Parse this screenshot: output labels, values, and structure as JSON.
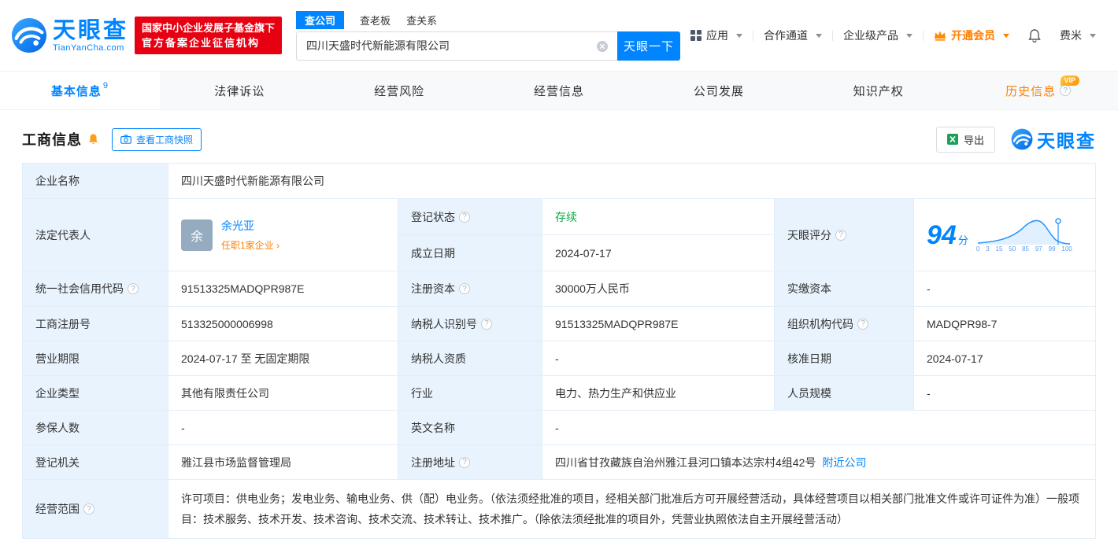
{
  "colors": {
    "accent": "#0084ff",
    "orange": "#ff8000",
    "green": "#0caa45",
    "red": "#e60012",
    "label_bg": "#e9f3fd"
  },
  "header": {
    "logo_cn": "天眼查",
    "logo_en": "TianYanCha.com",
    "badge_line1": "国家中小企业发展子基金旗下",
    "badge_line2": "官方备案企业征信机构",
    "search_tabs": [
      {
        "label": "查公司"
      },
      {
        "label": "查老板"
      },
      {
        "label": "查关系"
      }
    ],
    "search_value": "四川天盛时代新能源有限公司",
    "search_button": "天眼一下",
    "nav_app": "应用",
    "nav_coop": "合作通道",
    "nav_enterprise": "企业级产品",
    "nav_vip": "开通会员",
    "nav_user": "费米"
  },
  "tabs": [
    {
      "label": "基本信息",
      "count": "9"
    },
    {
      "label": "法律诉讼"
    },
    {
      "label": "经营风险"
    },
    {
      "label": "经营信息"
    },
    {
      "label": "公司发展"
    },
    {
      "label": "知识产权"
    },
    {
      "label": "历史信息",
      "vip": "VIP"
    }
  ],
  "section": {
    "title": "工商信息",
    "snapshot_button": "查看工商快照",
    "export_button": "导出",
    "brand": "天眼查"
  },
  "fields": {
    "company_name": {
      "label": "企业名称",
      "value": "四川天盛时代新能源有限公司"
    },
    "legal_rep": {
      "label": "法定代表人",
      "avatar": "余",
      "name": "余光亚",
      "note": "任职1家企业"
    },
    "reg_status": {
      "label": "登记状态",
      "value": "存续"
    },
    "establish_date": {
      "label": "成立日期",
      "value": "2024-07-17"
    },
    "score": {
      "label": "天眼评分",
      "value": "94",
      "unit": "分",
      "axis": [
        "0",
        "3",
        "15",
        "50",
        "85",
        "97",
        "99",
        "100"
      ]
    },
    "credit_code": {
      "label": "统一社会信用代码",
      "value": "91513325MADQPR987E"
    },
    "reg_capital": {
      "label": "注册资本",
      "value": "30000万人民币"
    },
    "paid_capital": {
      "label": "实缴资本",
      "value": "-"
    },
    "reg_number": {
      "label": "工商注册号",
      "value": "513325000006998"
    },
    "taxpayer_id": {
      "label": "纳税人识别号",
      "value": "91513325MADQPR987E"
    },
    "org_code": {
      "label": "组织机构代码",
      "value": "MADQPR98-7"
    },
    "business_term": {
      "label": "营业期限",
      "value": "2024-07-17 至 无固定期限"
    },
    "taxpayer_qual": {
      "label": "纳税人资质",
      "value": "-"
    },
    "approval_date": {
      "label": "核准日期",
      "value": "2024-07-17"
    },
    "company_type": {
      "label": "企业类型",
      "value": "其他有限责任公司"
    },
    "industry": {
      "label": "行业",
      "value": "电力、热力生产和供应业"
    },
    "staff_size": {
      "label": "人员规模",
      "value": "-"
    },
    "insured_count": {
      "label": "参保人数",
      "value": "-"
    },
    "english_name": {
      "label": "英文名称",
      "value": "-"
    },
    "reg_authority": {
      "label": "登记机关",
      "value": "雅江县市场监督管理局"
    },
    "reg_address": {
      "label": "注册地址",
      "value": "四川省甘孜藏族自治州雅江县河口镇本达宗村4组42号",
      "link": "附近公司"
    },
    "business_scope": {
      "label": "经营范围",
      "value": "许可项目：供电业务；发电业务、输电业务、供（配）电业务。（依法须经批准的项目，经相关部门批准后方可开展经营活动，具体经营项目以相关部门批准文件或许可证件为准）一般项目：技术服务、技术开发、技术咨询、技术交流、技术转让、技术推广。（除依法须经批准的项目外，凭营业执照依法自主开展经营活动）"
    }
  }
}
